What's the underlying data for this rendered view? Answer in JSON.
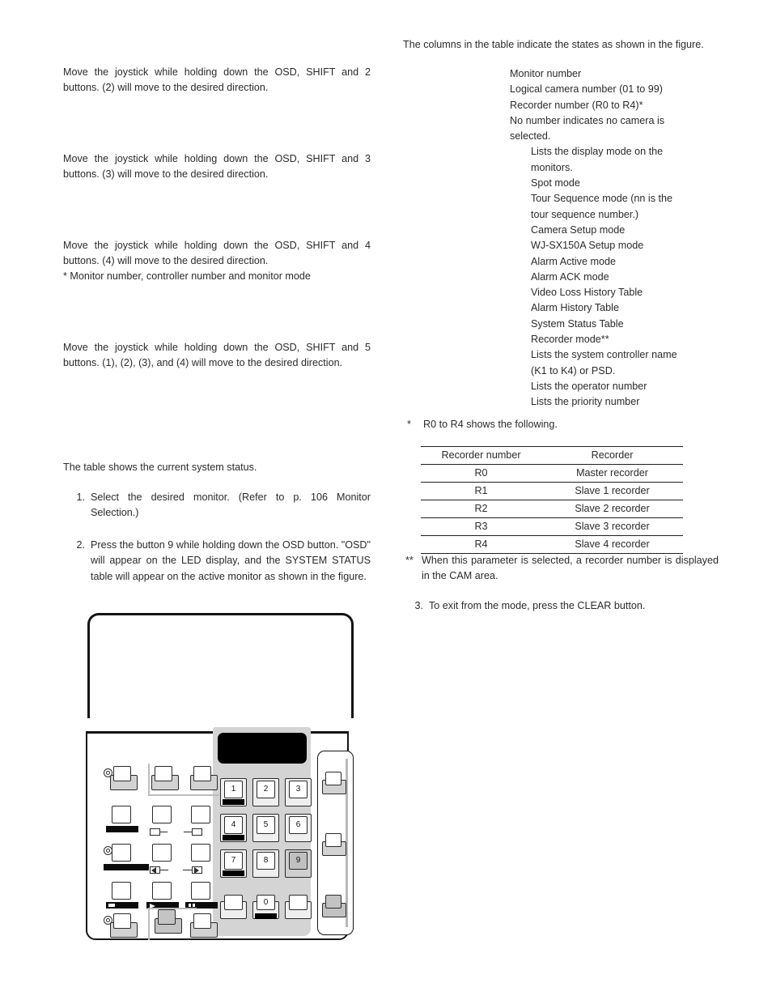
{
  "left_column": {
    "p1": "Move the joystick while holding down the OSD, SHIFT and 2 buttons. (2) will move to the desired direction.",
    "p2": "Move the joystick while holding down the OSD, SHIFT and 3 buttons. (3) will move to the desired direction.",
    "p3": "Move the joystick while holding down the OSD, SHIFT and 4 buttons. (4) will move to the desired direction.",
    "p3_note": "* Monitor number, controller number and monitor mode",
    "p4": "Move the joystick while holding down the OSD, SHIFT and 5 buttons. (1), (2), (3), and (4) will move to the desired direction.",
    "p5": "The table shows the current system status.",
    "step1_num": "1.",
    "step1_text": "Select the desired monitor. (Refer to p. 106 Monitor Selection.)",
    "step2_num": "2.",
    "step2_text": "Press the button 9 while holding down the OSD button. \"OSD\" will appear on the LED display, and the SYSTEM STATUS table will appear on the active monitor as shown in the figure."
  },
  "right_column": {
    "intro": "The columns in the table indicate the states as shown in the figure.",
    "state_lines": [
      {
        "text": "Monitor number",
        "indent": false
      },
      {
        "text": "Logical camera number (01 to 99)",
        "indent": false
      },
      {
        "text": "Recorder number (R0 to R4)*",
        "indent": false
      },
      {
        "text": "No number indicates no camera is",
        "indent": false
      },
      {
        "text": "selected.",
        "indent": false
      },
      {
        "text": "Lists the display mode on the",
        "indent": true
      },
      {
        "text": "monitors.",
        "indent": true
      },
      {
        "text": "Spot mode",
        "indent": true
      },
      {
        "text": "Tour Sequence mode (nn is the",
        "indent": true
      },
      {
        "text": "tour sequence number.)",
        "indent": true
      },
      {
        "text": "Camera Setup mode",
        "indent": true
      },
      {
        "text": "WJ-SX150A Setup mode",
        "indent": true
      },
      {
        "text": "Alarm Active mode",
        "indent": true
      },
      {
        "text": "Alarm ACK mode",
        "indent": true
      },
      {
        "text": "Video Loss History Table",
        "indent": true
      },
      {
        "text": "Alarm History  Table",
        "indent": true
      },
      {
        "text": "System Status Table",
        "indent": true
      },
      {
        "text": "Recorder mode**",
        "indent": true
      },
      {
        "text": "Lists the system controller name",
        "indent": true
      },
      {
        "text": "(K1 to K4) or PSD.",
        "indent": true
      },
      {
        "text": "Lists the operator number",
        "indent": true
      },
      {
        "text": "Lists the priority number",
        "indent": true
      }
    ],
    "footnote_single_mark": "*",
    "footnote_single_text": "R0 to R4 shows the following.",
    "footnote_double_mark": "**",
    "footnote_double_text": "When this parameter is selected, a recorder number is displayed in the CAM area.",
    "step3_num": "3.",
    "step3_text": "To exit from the mode, press the CLEAR button.",
    "table": {
      "headers": [
        "Recorder number",
        "Recorder"
      ],
      "rows": [
        [
          "R0",
          "Master recorder"
        ],
        [
          "R1",
          "Slave 1 recorder"
        ],
        [
          "R2",
          "Slave 2 recorder"
        ],
        [
          "R3",
          "Slave 3 recorder"
        ],
        [
          "R4",
          "Slave 4 recorder"
        ]
      ]
    }
  },
  "figure": {
    "caption": "",
    "keypad": {
      "keys": [
        {
          "label": "1",
          "led": true,
          "highlight": false
        },
        {
          "label": "2",
          "led": false,
          "highlight": false
        },
        {
          "label": "3",
          "led": false,
          "highlight": false
        },
        {
          "label": "4",
          "led": true,
          "highlight": false
        },
        {
          "label": "5",
          "led": false,
          "highlight": false
        },
        {
          "label": "6",
          "led": false,
          "highlight": false
        },
        {
          "label": "7",
          "led": true,
          "highlight": false
        },
        {
          "label": "8",
          "led": false,
          "highlight": false
        },
        {
          "label": "9",
          "led": false,
          "highlight": true
        }
      ],
      "bottom_keys": [
        {
          "label": "",
          "led": false
        },
        {
          "label": "0",
          "led": true
        },
        {
          "label": "",
          "led": false
        }
      ]
    }
  },
  "colors": {
    "text": "#2b2b2b",
    "rule": "#231f20",
    "panel_gray": "#d4d4d4",
    "key_gray": "#c0c0c0",
    "led_black": "#000000"
  }
}
